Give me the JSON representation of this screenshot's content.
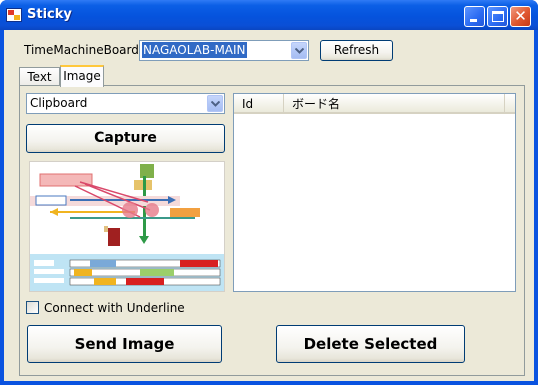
{
  "window": {
    "title": "Sticky"
  },
  "top": {
    "board_label": "TimeMachineBoard",
    "board_value": "NAGAOLAB-MAIN",
    "refresh_label": "Refresh"
  },
  "tabs": [
    {
      "label": "Text",
      "active": false
    },
    {
      "label": "Image",
      "active": true
    }
  ],
  "image_tab": {
    "source_value": "Clipboard",
    "capture_label": "Capture",
    "checkbox_label": "Connect with Underline",
    "checkbox_checked": false,
    "send_label": "Send Image",
    "delete_label": "Delete Selected"
  },
  "listview": {
    "columns": [
      "Id",
      "ボード名"
    ],
    "rows": []
  },
  "colors": {
    "titlebar": "#0553dd",
    "client": "#ece9d8",
    "selection": "#316ac5",
    "button_border": "#003c74"
  }
}
